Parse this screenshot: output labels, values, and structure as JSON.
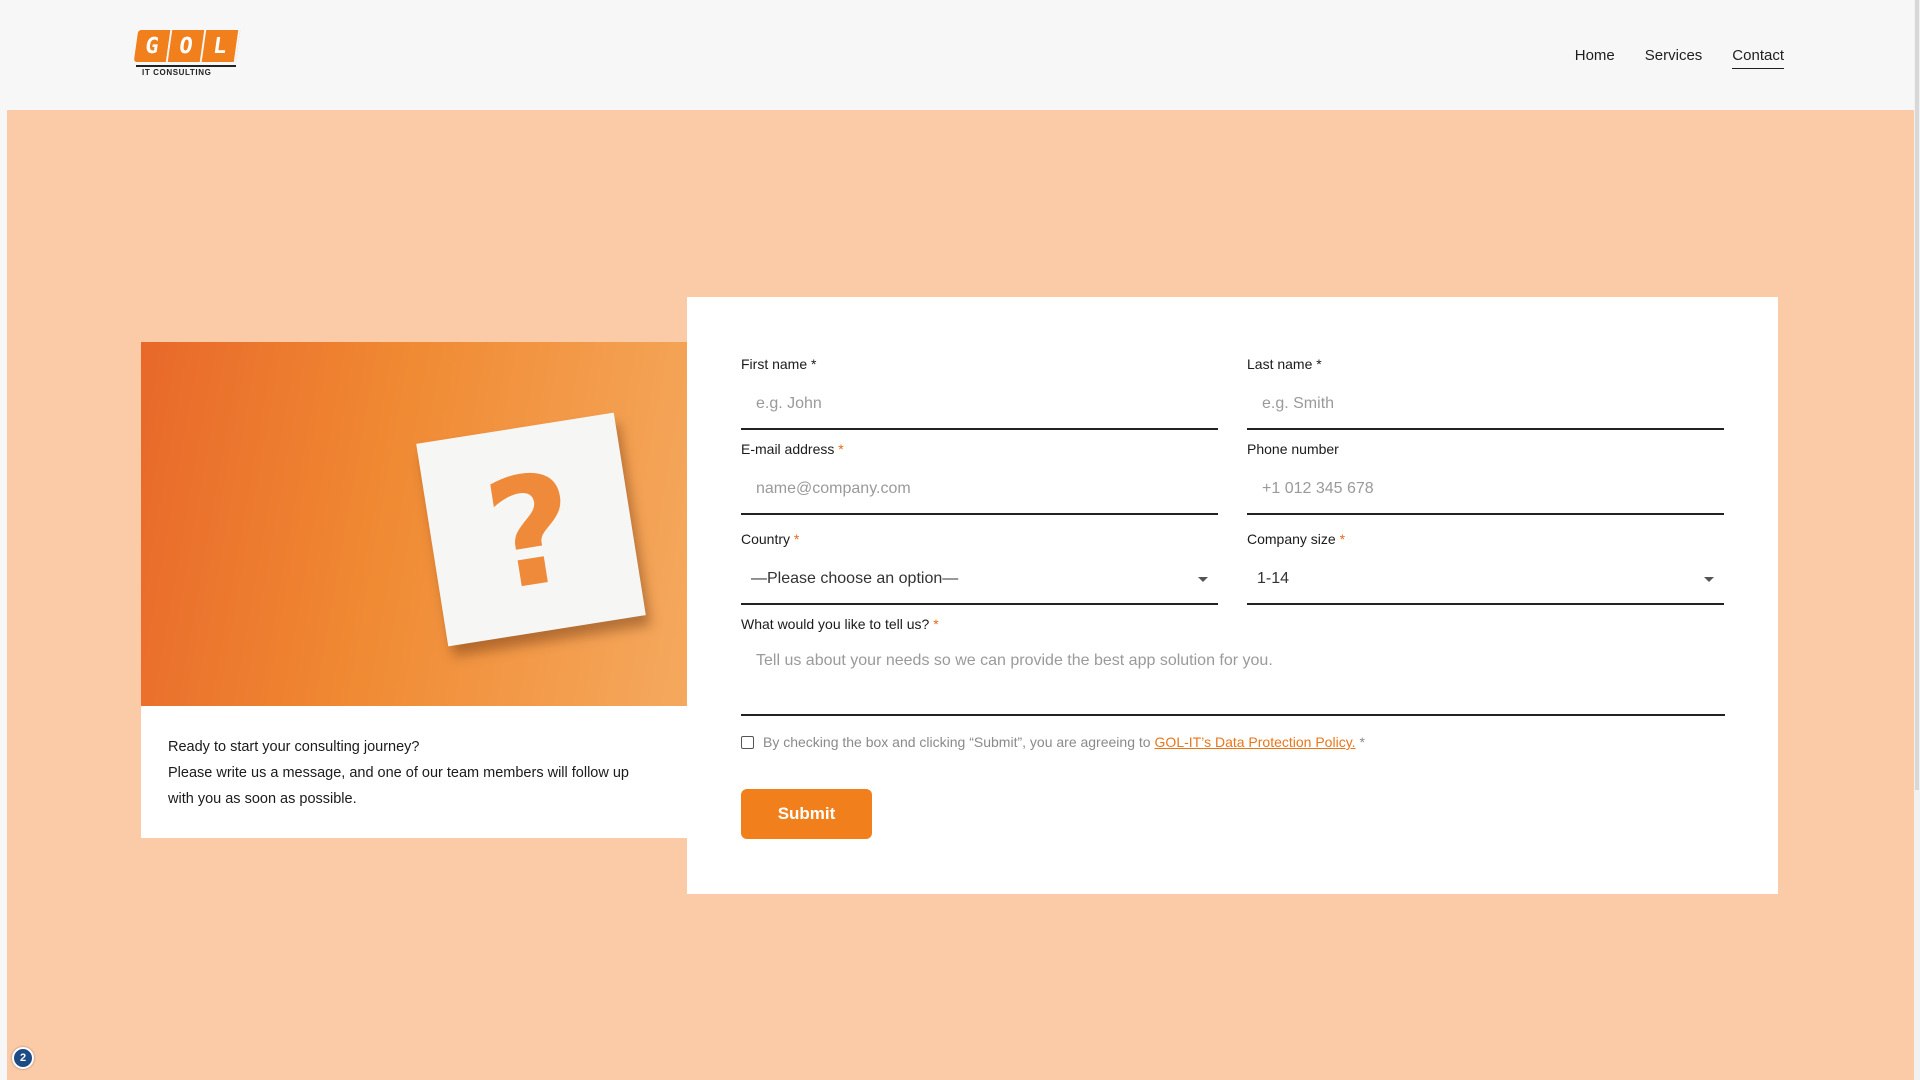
{
  "logo": {
    "letters": [
      "G",
      "O",
      "L"
    ],
    "subtitle": "IT CONSULTING"
  },
  "nav": {
    "home": "Home",
    "services": "Services",
    "contact": "Contact",
    "active": "contact"
  },
  "intro": {
    "line1": "Ready to start your consulting journey?",
    "line2": "Please write us a message, and one of our team members will follow up with you as soon as possible."
  },
  "form": {
    "first_name": {
      "label": "First name *",
      "placeholder": "e.g. John"
    },
    "last_name": {
      "label": "Last name *",
      "placeholder": "e.g. Smith"
    },
    "email": {
      "label": "E-mail address",
      "required": "*",
      "placeholder": "name@company.com"
    },
    "phone": {
      "label": "Phone number",
      "placeholder": "+1 012 345 678"
    },
    "country": {
      "label": "Country",
      "required": "*",
      "value": "—Please choose an option—"
    },
    "company_size": {
      "label": "Company size",
      "required": "*",
      "value": "1-14"
    },
    "message": {
      "label": "What would you like to tell us?",
      "required": "*",
      "placeholder": "Tell us about your needs so we can provide the best app solution for you."
    },
    "consent": {
      "text": "By checking the box and clicking “Submit”, you are agreeing to",
      "link": "GOL-IT’s Data Protection Policy.",
      "required": "*",
      "checked": false
    },
    "submit_label": "Submit"
  },
  "image": {
    "symbol": "?"
  },
  "widget": {
    "label": "2"
  },
  "colors": {
    "accent": "#f07f1c",
    "hero_bg": "#fbcaa6",
    "card_bg": "#ffffff"
  }
}
